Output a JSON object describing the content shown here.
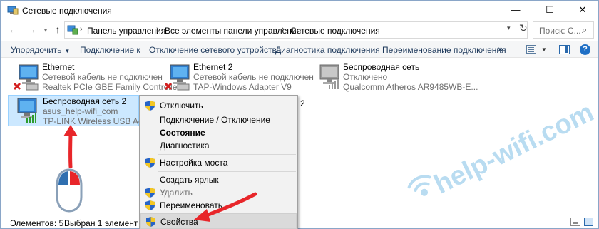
{
  "window": {
    "title": "Сетевые подключения",
    "controls": {
      "minimize": "—",
      "maximize": "☐",
      "close": "✕"
    }
  },
  "address": {
    "crumbs": [
      "Панель управления",
      "Все элементы панели управления",
      "Сетевые подключения"
    ],
    "search_placeholder": "Поиск: С..."
  },
  "toolbar": {
    "organize": "Упорядочить",
    "connect": "Подключение к",
    "disable": "Отключение сетевого устройства",
    "diagnose": "Диагностика подключения",
    "rename": "Переименование подключения",
    "more": "»"
  },
  "adapters": [
    {
      "name": "Ethernet",
      "status": "Сетевой кабель не подключен",
      "device": "Realtek PCIe GBE Family Controller",
      "state": "disconnected"
    },
    {
      "name": "Ethernet 2",
      "status": "Сетевой кабель не подключен",
      "device": "TAP-Windows Adapter V9",
      "state": "disconnected"
    },
    {
      "name": "Беспроводная сеть",
      "status": "Отключено",
      "device": "Qualcomm Atheros AR9485WB-E...",
      "state": "disabled"
    },
    {
      "name": "Беспроводная сеть 2",
      "status": "asus_help-wifi_com",
      "device": "TP-LINK Wireless USB Adapter",
      "state": "connected"
    }
  ],
  "stray_text": "2",
  "context_menu": {
    "items": [
      {
        "label": "Отключить",
        "shield": true,
        "bold": false,
        "disabled": false
      },
      {
        "label": "Подключение / Отключение",
        "shield": false,
        "bold": false,
        "disabled": false
      },
      {
        "label": "Состояние",
        "shield": false,
        "bold": true,
        "disabled": false
      },
      {
        "label": "Диагностика",
        "shield": false,
        "bold": false,
        "disabled": false
      },
      {
        "label": "Настройка моста",
        "shield": true,
        "bold": false,
        "disabled": false
      },
      {
        "label": "Создать ярлык",
        "shield": false,
        "bold": false,
        "disabled": false
      },
      {
        "label": "Удалить",
        "shield": true,
        "bold": false,
        "disabled": true
      },
      {
        "label": "Переименовать",
        "shield": true,
        "bold": false,
        "disabled": false
      },
      {
        "label": "Свойства",
        "shield": true,
        "bold": false,
        "disabled": false,
        "hover": true
      }
    ]
  },
  "status": {
    "count": "Элементов: 5",
    "selected": "Выбран 1 элемент"
  },
  "watermark": "help-wifi.com",
  "colors": {
    "arrow": "#e8262a",
    "selection": "#cce8ff",
    "watermark": "#b9dcf1",
    "menu_bg": "#f2f2f2"
  }
}
